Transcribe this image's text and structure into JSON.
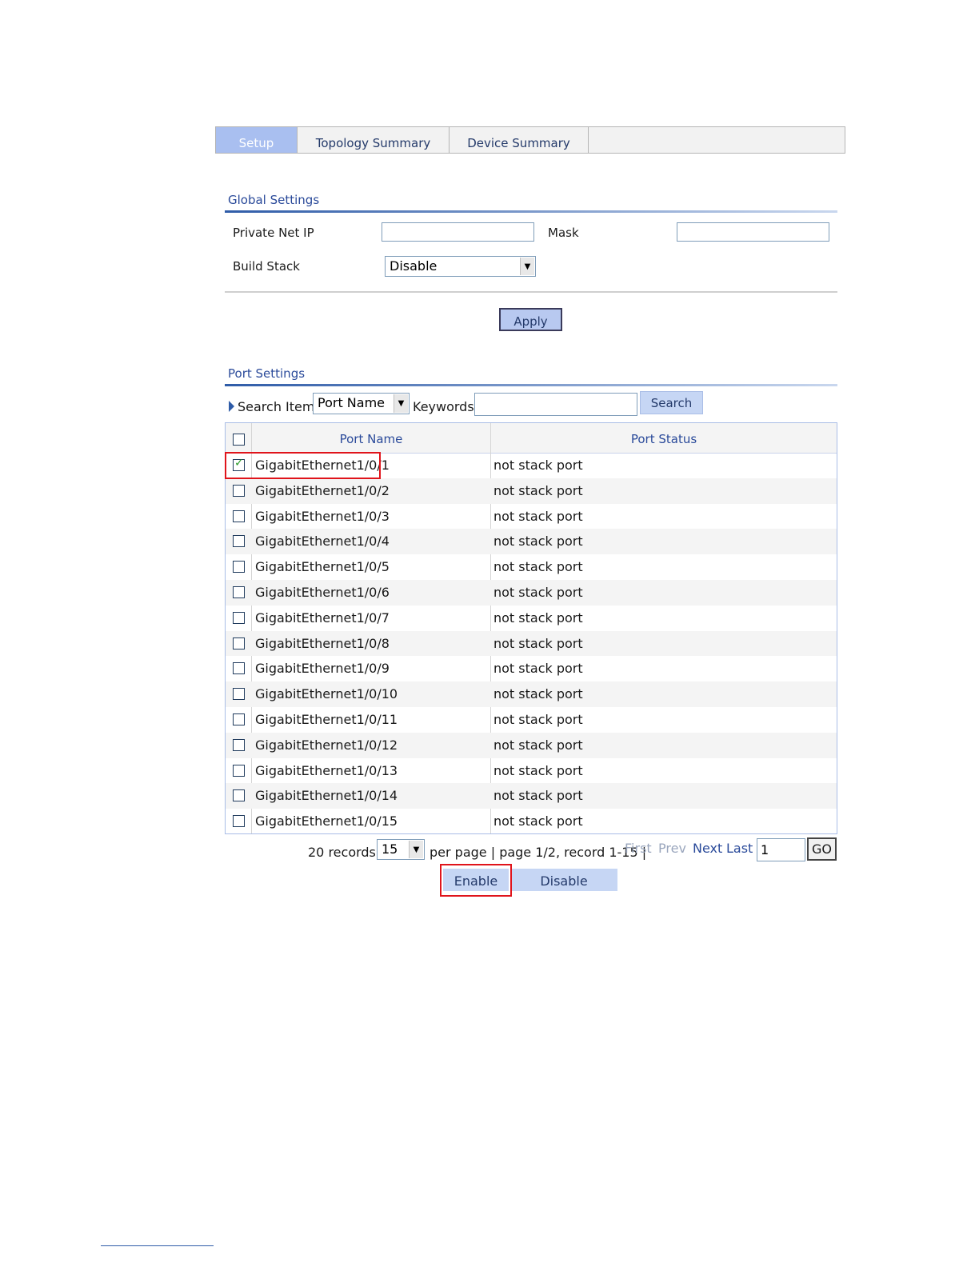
{
  "tabs": [
    {
      "label": "Setup",
      "active": true
    },
    {
      "label": "Topology Summary",
      "active": false
    },
    {
      "label": "Device Summary",
      "active": false
    }
  ],
  "global_settings": {
    "title": "Global Settings",
    "private_net_ip_label": "Private Net IP",
    "private_net_ip_value": "",
    "mask_label": "Mask",
    "mask_value": "",
    "build_stack_label": "Build Stack",
    "build_stack_value": "Disable",
    "apply_label": "Apply"
  },
  "port_settings": {
    "title": "Port Settings",
    "search_item_label": "Search Item:",
    "search_item_value": "Port Name",
    "keywords_label": "Keywords:",
    "keywords_value": "",
    "search_button": "Search",
    "columns": [
      "Port Name",
      "Port Status"
    ],
    "rows": [
      {
        "port": "GigabitEthernet1/0/1",
        "status": "not stack port",
        "checked": true
      },
      {
        "port": "GigabitEthernet1/0/2",
        "status": "not stack port",
        "checked": false
      },
      {
        "port": "GigabitEthernet1/0/3",
        "status": "not stack port",
        "checked": false
      },
      {
        "port": "GigabitEthernet1/0/4",
        "status": "not stack port",
        "checked": false
      },
      {
        "port": "GigabitEthernet1/0/5",
        "status": "not stack port",
        "checked": false
      },
      {
        "port": "GigabitEthernet1/0/6",
        "status": "not stack port",
        "checked": false
      },
      {
        "port": "GigabitEthernet1/0/7",
        "status": "not stack port",
        "checked": false
      },
      {
        "port": "GigabitEthernet1/0/8",
        "status": "not stack port",
        "checked": false
      },
      {
        "port": "GigabitEthernet1/0/9",
        "status": "not stack port",
        "checked": false
      },
      {
        "port": "GigabitEthernet1/0/10",
        "status": "not stack port",
        "checked": false
      },
      {
        "port": "GigabitEthernet1/0/11",
        "status": "not stack port",
        "checked": false
      },
      {
        "port": "GigabitEthernet1/0/12",
        "status": "not stack port",
        "checked": false
      },
      {
        "port": "GigabitEthernet1/0/13",
        "status": "not stack port",
        "checked": false
      },
      {
        "port": "GigabitEthernet1/0/14",
        "status": "not stack port",
        "checked": false
      },
      {
        "port": "GigabitEthernet1/0/15",
        "status": "not stack port",
        "checked": false
      }
    ]
  },
  "pagination": {
    "records_text": "20 records,",
    "per_page_value": "15",
    "page_info": "per page | page 1/2, record 1-15 |",
    "first": "First",
    "prev": "Prev",
    "next": "Next",
    "last": "Last",
    "page_input": "1",
    "go": "GO"
  },
  "actions": {
    "enable": "Enable",
    "disable": "Disable"
  },
  "colors": {
    "accent": "#2f5ca8",
    "highlight": "#e0141b",
    "disabled_link": "#9aa6bd"
  },
  "icons": [
    "chevron-down-icon",
    "triangle-right-icon",
    "checkmark-icon"
  ]
}
